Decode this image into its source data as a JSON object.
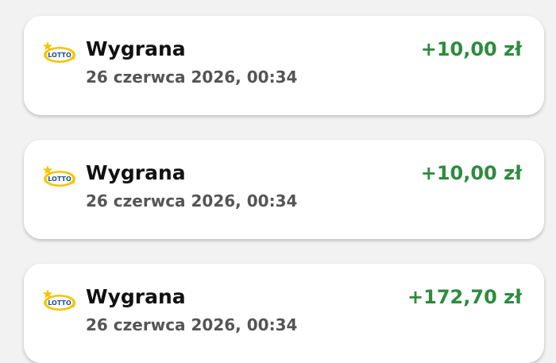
{
  "colors": {
    "background": "#f2f2f2",
    "card": "#ffffff",
    "title": "#111111",
    "date": "#555555",
    "amount_positive": "#2e8b3e",
    "lotto_blue": "#1f4e9c",
    "lotto_yellow": "#f5c400"
  },
  "transactions": [
    {
      "icon": "lotto-logo-icon",
      "logo_text": "LOTTO",
      "title": "Wygrana",
      "date": "26 czerwca 2026, 00:34",
      "amount": "+10,00 zł"
    },
    {
      "icon": "lotto-logo-icon",
      "logo_text": "LOTTO",
      "title": "Wygrana",
      "date": "26 czerwca 2026, 00:34",
      "amount": "+10,00 zł"
    },
    {
      "icon": "lotto-logo-icon",
      "logo_text": "LOTTO",
      "title": "Wygrana",
      "date": "26 czerwca 2026, 00:34",
      "amount": "+172,70 zł"
    }
  ]
}
